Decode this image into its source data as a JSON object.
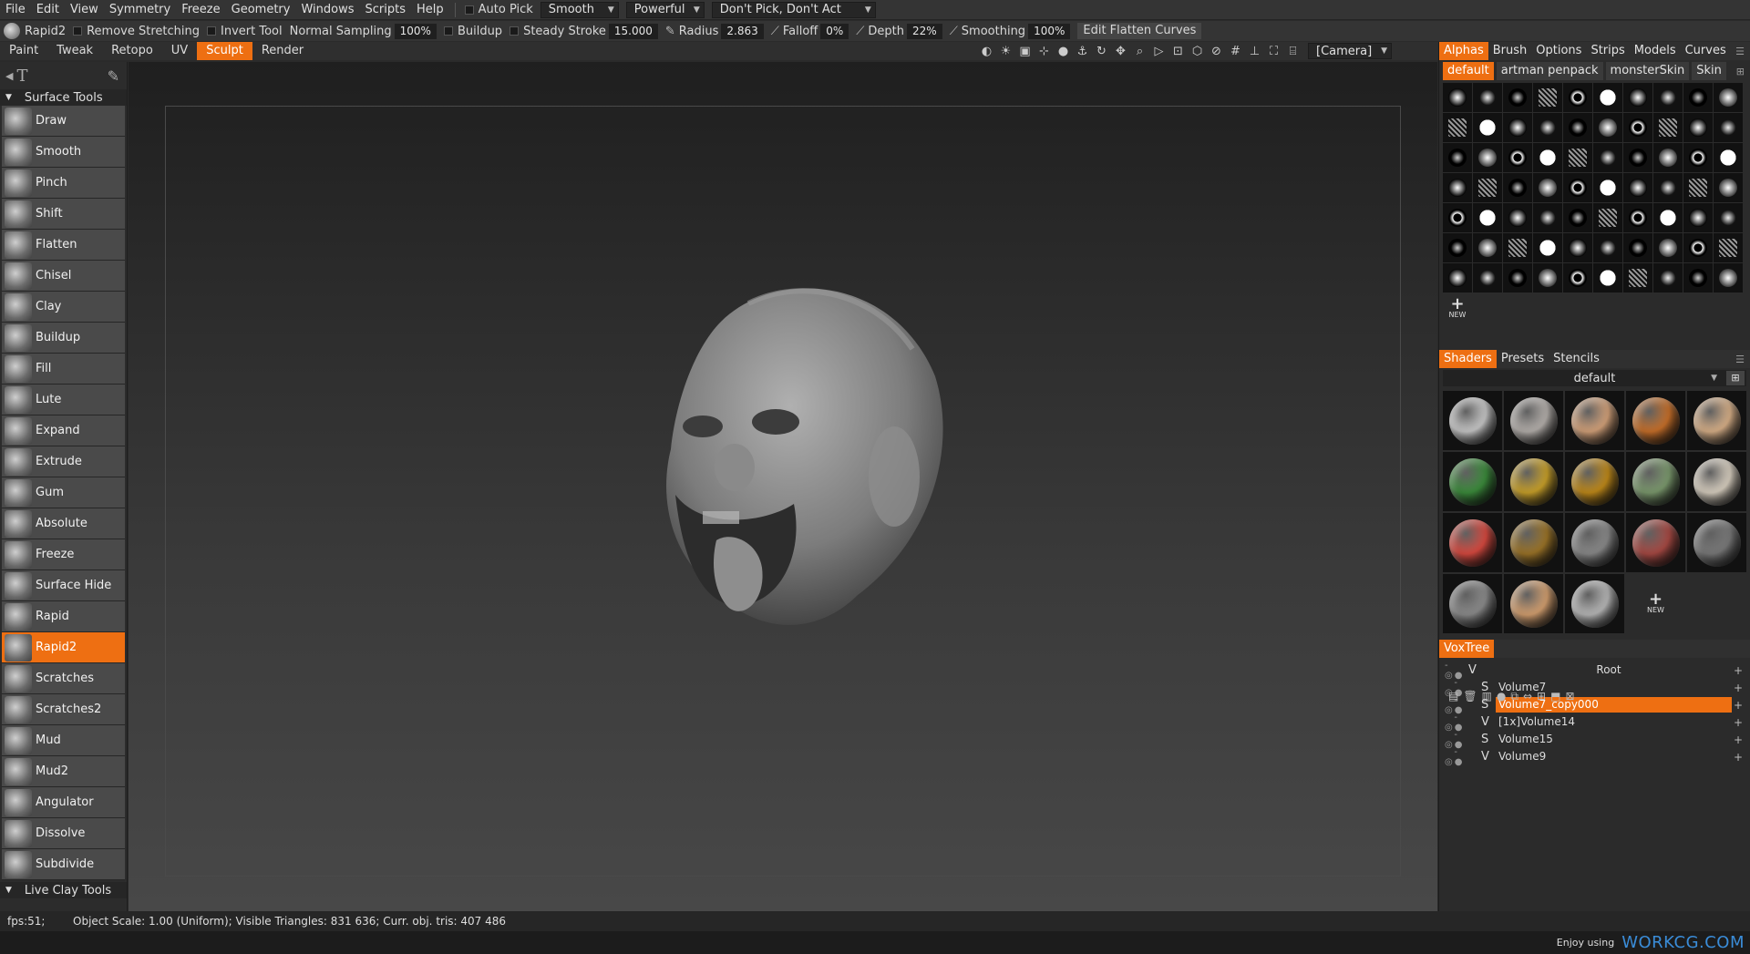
{
  "menubar": {
    "items": [
      "File",
      "Edit",
      "View",
      "Symmetry",
      "Freeze",
      "Geometry",
      "Windows",
      "Scripts",
      "Help"
    ],
    "auto_pick": "Auto Pick",
    "mode_select": "Smooth",
    "strength_select": "Powerful",
    "pick_select": "Don't Pick, Don't Act"
  },
  "toolbar": {
    "current_tool": "Rapid2",
    "remove_stretching": "Remove Stretching",
    "invert_tool": "Invert Tool",
    "normal_sampling_label": "Normal Sampling",
    "normal_sampling_value": "100%",
    "buildup": "Buildup",
    "steady_stroke_label": "Steady Stroke",
    "steady_stroke_value": "15.000",
    "radius_label": "Radius",
    "radius_value": "2.863",
    "falloff_label": "Falloff",
    "falloff_value": "0%",
    "depth_label": "Depth",
    "depth_value": "22%",
    "smoothing_label": "Smoothing",
    "smoothing_value": "100%",
    "edit_curves": "Edit Flatten Curves"
  },
  "modes": {
    "items": [
      "Paint",
      "Tweak",
      "Retopo",
      "UV",
      "Sculpt",
      "Render"
    ],
    "active": "Sculpt",
    "camera": "[Camera]"
  },
  "left_panel": {
    "section_title": "Surface Tools",
    "tools": [
      "Draw",
      "Smooth",
      "Pinch",
      "Shift",
      "Flatten",
      "Chisel",
      "Clay",
      "Buildup",
      "Fill",
      "Lute",
      "Expand",
      "Extrude",
      "Gum",
      "Absolute",
      "Freeze",
      "Surface Hide",
      "Rapid",
      "Rapid2",
      "Scratches",
      "Scratches2",
      "Mud",
      "Mud2",
      "Angulator",
      "Dissolve",
      "Subdivide"
    ],
    "active_tool": "Rapid2",
    "next_section": "Live Clay Tools"
  },
  "alphas_panel": {
    "tabs": [
      "Alphas",
      "Brush",
      "Options",
      "Strips",
      "Models",
      "Curves"
    ],
    "active_tab": "Alphas",
    "sets": [
      "default",
      "artman penpack",
      "monsterSkin",
      "Skin"
    ],
    "active_set": "default",
    "new_label": "NEW"
  },
  "shaders_panel": {
    "tabs": [
      "Shaders",
      "Presets",
      "Stencils"
    ],
    "active_tab": "Shaders",
    "selected": "default",
    "new_label": "NEW",
    "colors": [
      "#c8c8c8",
      "#b5b0ac",
      "#d4a27a",
      "#c8702a",
      "#d8b088",
      "#3c8c3c",
      "#c9a12a",
      "#c08a1a",
      "#7c9a6e",
      "#d8cfc0",
      "#d84a40",
      "#9c7428",
      "#8a8a8a",
      "#a84a44",
      "#7a7a7a",
      "#8c8c8c",
      "#d4a070",
      "#b8b8b8"
    ]
  },
  "voxtree": {
    "title": "VoxTree",
    "root": "Root",
    "rows": [
      {
        "type": "S",
        "name": "Volume7"
      },
      {
        "type": "S",
        "name": "Volume7_copy000"
      },
      {
        "type": "V",
        "name": "[1x]Volume14"
      },
      {
        "type": "S",
        "name": "Volume15"
      },
      {
        "type": "V",
        "name": "Volume9"
      }
    ],
    "selected": "Volume7_copy000"
  },
  "status": {
    "fps": "fps:51;",
    "info": "Object Scale: 1.00 (Uniform); Visible Triangles: 831 636; Curr. obj. tris: 407 486"
  },
  "footer": {
    "enjoy": "Enjoy using",
    "brand": "WORKCG.COM"
  },
  "colors": {
    "accent": "#ee6f12",
    "brand": "#3a8cd8"
  }
}
